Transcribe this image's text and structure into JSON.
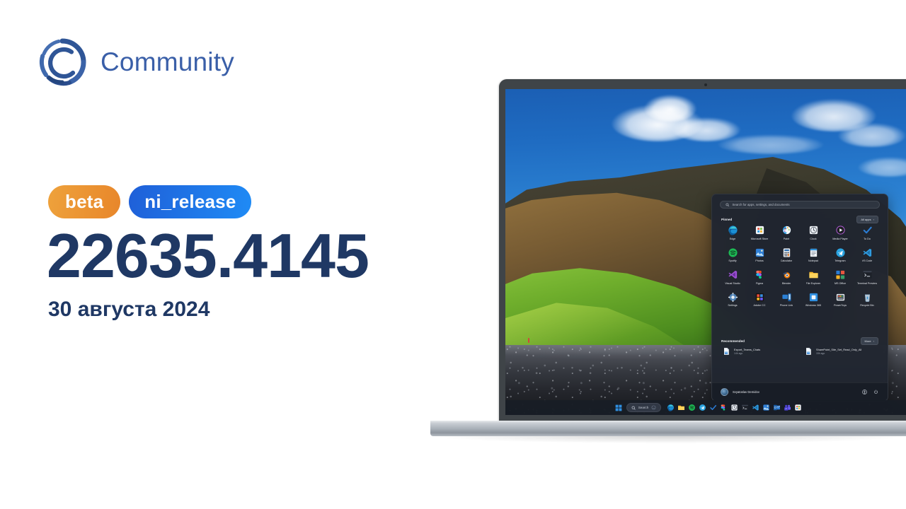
{
  "brand": {
    "name": "Community",
    "logo_icon": "community-c-logo",
    "logo_color": "#3a5fa8",
    "text_color": "#3a5fa8"
  },
  "release": {
    "badges": [
      {
        "label": "beta",
        "kind": "channel",
        "color_from": "#eea23c",
        "color_to": "#e8862a"
      },
      {
        "label": "ni_release",
        "kind": "branch",
        "color_from": "#1f5fd8",
        "color_to": "#1f8bf5"
      }
    ],
    "build_number": "22635.4145",
    "date": "30 августа 2024",
    "text_color": "#1f3864"
  },
  "device": {
    "type": "laptop",
    "wallpaper_description": "Iceland black pebble beach with green cliff and blue sky"
  },
  "start_menu": {
    "search": {
      "placeholder": "Search for apps, settings, and documents",
      "icon": "search-icon"
    },
    "pinned": {
      "title": "Pinned",
      "all_apps_label": "All apps",
      "all_apps_chevron": "chevron-right-icon",
      "apps": [
        {
          "label": "Edge",
          "icon": "edge-icon"
        },
        {
          "label": "Microsoft Store",
          "icon": "microsoft-store-icon"
        },
        {
          "label": "Paint",
          "icon": "paint-icon"
        },
        {
          "label": "Clock",
          "icon": "clock-icon"
        },
        {
          "label": "Media Player",
          "icon": "media-player-icon"
        },
        {
          "label": "To Do",
          "icon": "to-do-icon"
        },
        {
          "label": "Spotify",
          "icon": "spotify-icon"
        },
        {
          "label": "Photos",
          "icon": "photos-icon"
        },
        {
          "label": "Calculator",
          "icon": "calculator-icon"
        },
        {
          "label": "Notepad",
          "icon": "notepad-icon"
        },
        {
          "label": "Telegram",
          "icon": "telegram-icon"
        },
        {
          "label": "VS Code",
          "icon": "vs-code-icon"
        },
        {
          "label": "Visual Studio",
          "icon": "visual-studio-icon"
        },
        {
          "label": "Figma",
          "icon": "figma-icon"
        },
        {
          "label": "Blender",
          "icon": "blender-icon"
        },
        {
          "label": "File Explorer",
          "icon": "file-explorer-icon"
        },
        {
          "label": "MS Office",
          "icon": "ms-office-icon"
        },
        {
          "label": "Terminal Preview",
          "icon": "terminal-icon"
        },
        {
          "label": "Settings",
          "icon": "settings-gear-icon"
        },
        {
          "label": "Adobe CC",
          "icon": "adobe-cc-icon"
        },
        {
          "label": "Phone Link",
          "icon": "phone-link-icon"
        },
        {
          "label": "Windows 365",
          "icon": "windows-365-icon"
        },
        {
          "label": "PowerToys",
          "icon": "powertoys-icon"
        },
        {
          "label": "Recycle Bin",
          "icon": "recycle-bin-icon"
        }
      ]
    },
    "recommended": {
      "title": "Recommended",
      "more_label": "More",
      "more_chevron": "chevron-right-icon",
      "items": [
        {
          "name": "Export_Teams_Chats",
          "subtitle": "14h ago",
          "icon": "document-icon"
        },
        {
          "name": "SharePoint_Site_Set_Read_Only_All",
          "subtitle": "15h ago",
          "icon": "document-icon"
        }
      ]
    },
    "account": {
      "user_name": "Svyatoslav Demidov",
      "avatar_icon": "avatar",
      "actions": [
        {
          "name": "accessibility",
          "icon": "accessibility-icon"
        },
        {
          "name": "power",
          "icon": "power-icon"
        }
      ]
    }
  },
  "taskbar": {
    "start_label": "Start",
    "start_icon": "windows-start-icon",
    "search": {
      "label": "Search",
      "icon": "search-icon",
      "mic_icon": "copilot-icon"
    },
    "items": [
      {
        "label": "Edge",
        "icon": "edge-icon"
      },
      {
        "label": "File Explorer",
        "icon": "file-explorer-icon"
      },
      {
        "label": "Spotify",
        "icon": "spotify-icon"
      },
      {
        "label": "Telegram",
        "icon": "telegram-icon"
      },
      {
        "label": "To Do",
        "icon": "to-do-icon"
      },
      {
        "label": "Figma",
        "icon": "figma-icon"
      },
      {
        "label": "Clock",
        "icon": "clock-icon"
      },
      {
        "label": "Terminal",
        "icon": "terminal-icon"
      },
      {
        "label": "VS Code",
        "icon": "vs-code-icon"
      },
      {
        "label": "Photos",
        "icon": "photos-icon"
      },
      {
        "label": "Outlook",
        "icon": "outlook-icon"
      },
      {
        "label": "Teams",
        "icon": "teams-icon"
      },
      {
        "label": "Store",
        "icon": "microsoft-store-icon"
      }
    ]
  }
}
